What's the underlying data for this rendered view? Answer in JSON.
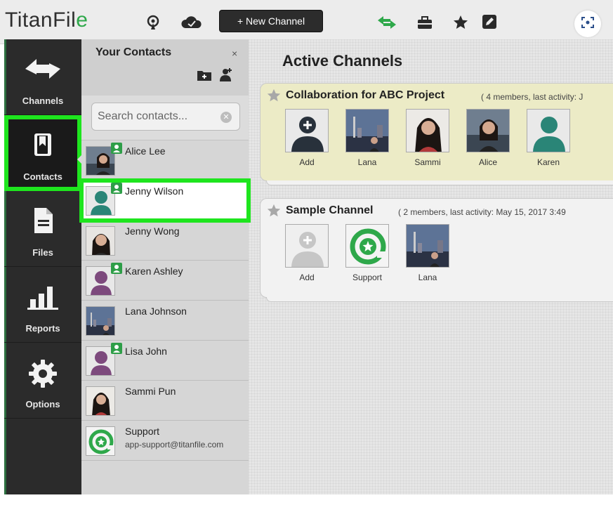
{
  "app": {
    "logo_text": "TitanFil",
    "logo_accent": "e",
    "new_channel_label": "+ New Channel",
    "brand_green": "#2ea84a",
    "highlight_green": "#1ee51e"
  },
  "toolbar_icons": [
    "broadcast-icon",
    "cloud-sync-icon",
    "swap-arrows-icon",
    "toolbox-icon",
    "star-icon",
    "edit-icon",
    "screen-capture-icon"
  ],
  "nav": {
    "items": [
      {
        "label": "Channels",
        "icon": "swap-arrows-icon",
        "active": false
      },
      {
        "label": "Contacts",
        "icon": "bookmark-book-icon",
        "active": true
      },
      {
        "label": "Files",
        "icon": "document-icon",
        "active": false
      },
      {
        "label": "Reports",
        "icon": "bar-chart-icon",
        "active": false
      },
      {
        "label": "Options",
        "icon": "gear-icon",
        "active": false
      }
    ]
  },
  "contacts": {
    "title": "Your Contacts",
    "close": "×",
    "search_placeholder": "Search contacts...",
    "items": [
      {
        "name": "Alice Lee",
        "sub": "",
        "avatar": "photo",
        "badge": true,
        "selected": false
      },
      {
        "name": "Jenny Wilson",
        "sub": "",
        "avatar": "teal-silhouette",
        "badge": true,
        "selected": true
      },
      {
        "name": "Jenny Wong",
        "sub": "",
        "avatar": "photo",
        "badge": false,
        "selected": false
      },
      {
        "name": "Karen Ashley",
        "sub": "",
        "avatar": "purple-silhouette",
        "badge": true,
        "selected": false
      },
      {
        "name": "Lana Johnson",
        "sub": "",
        "avatar": "city-photo",
        "badge": false,
        "selected": false
      },
      {
        "name": "Lisa John",
        "sub": "",
        "avatar": "purple-silhouette",
        "badge": true,
        "selected": false
      },
      {
        "name": "Sammi Pun",
        "sub": "",
        "avatar": "photo",
        "badge": false,
        "selected": false
      },
      {
        "name": "Support",
        "sub": "app-support@titanfile.com",
        "avatar": "titanfile-logo",
        "badge": false,
        "selected": false
      }
    ]
  },
  "main": {
    "title": "Active Channels",
    "channels": [
      {
        "name": "Collaboration for ABC Project",
        "meta": "( 4 members, last activity: J",
        "members": [
          "Add",
          "Lana",
          "Sammi",
          "Alice",
          "Karen"
        ]
      },
      {
        "name": "Sample Channel",
        "meta": "( 2 members, last activity: May 15, 2017 3:49",
        "members": [
          "Add",
          "Support",
          "Lana"
        ]
      }
    ]
  }
}
